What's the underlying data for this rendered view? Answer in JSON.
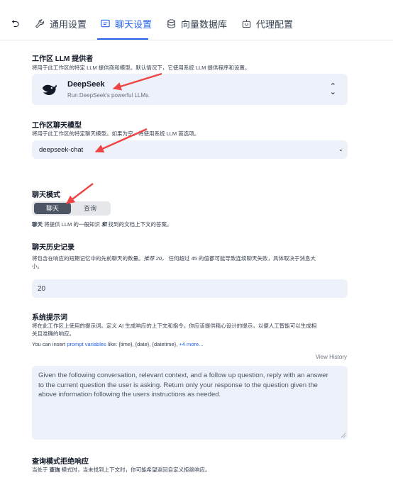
{
  "tabs": [
    {
      "label": "通用设置",
      "icon": "wrench-icon"
    },
    {
      "label": "聊天设置",
      "icon": "chat-icon"
    },
    {
      "label": "向量数据库",
      "icon": "database-icon"
    },
    {
      "label": "代理配置",
      "icon": "robot-icon"
    }
  ],
  "active_tab": "聊天设置",
  "provider": {
    "label": "工作区 LLM 提供者",
    "desc": "将用于此工作区的特定 LLM 提供商和模型。默认情况下，它使用系统 LLM 提供程序和设置。",
    "name": "DeepSeek",
    "subtitle": "Run DeepSeek's powerful LLMs."
  },
  "model": {
    "label": "工作区聊天模型",
    "desc": "将用于此工作区的特定聊天模型。如果为空，将使用系统 LLM 首选项。",
    "value": "deepseek-chat"
  },
  "chat_mode": {
    "label": "聊天模式",
    "options": [
      "聊天",
      "查询"
    ],
    "selected": "聊天",
    "desc_prefix": "聊天",
    "desc_rest": " 将提供 LLM 的一般知识 ",
    "desc_and": "和",
    "desc_end": " 找到的文档上下文的答案。"
  },
  "history": {
    "label": "聊天历史记录",
    "desc_line1_a": "将包含在响应的短期记忆中的先前聊天的数量。",
    "desc_line1_rec": "推荐 20。",
    "desc_line1_b": " 任何超过 45 的值都可能导致连续聊天失败，具体取决于消息大",
    "desc_line2": "小。",
    "value": "20"
  },
  "system_prompt": {
    "label": "系统提示词",
    "desc_line1": "将在此工作区上使用的提示词。定义 AI 生成响应的上下文和指令。你应该提供精心设计的提示，以便人工智能可以生成相",
    "desc_line2": "关且准确的响应。",
    "insert_prefix": "You can insert ",
    "insert_link": "prompt variables",
    "insert_like": " like: ",
    "var1": "{time}",
    "var2": "{date}",
    "var3": "{datetime}",
    "more": "+4 more...",
    "view_history": "View History",
    "text": "Given the following conversation, relevant context, and a follow up question, reply with an answer to the current question the user is asking. Return only your response to the question given the above information following the users instructions as needed."
  },
  "refusal": {
    "label": "查询模式拒绝响应",
    "desc_a": "当处于 ",
    "desc_mode": "查询",
    "desc_b": " 模式时，当未找到上下文时，你可能希望返回自定义拒绝响应。"
  },
  "colors": {
    "accent": "#2563eb",
    "arrow": "#ef4444",
    "field_bg": "#edf1f9"
  }
}
